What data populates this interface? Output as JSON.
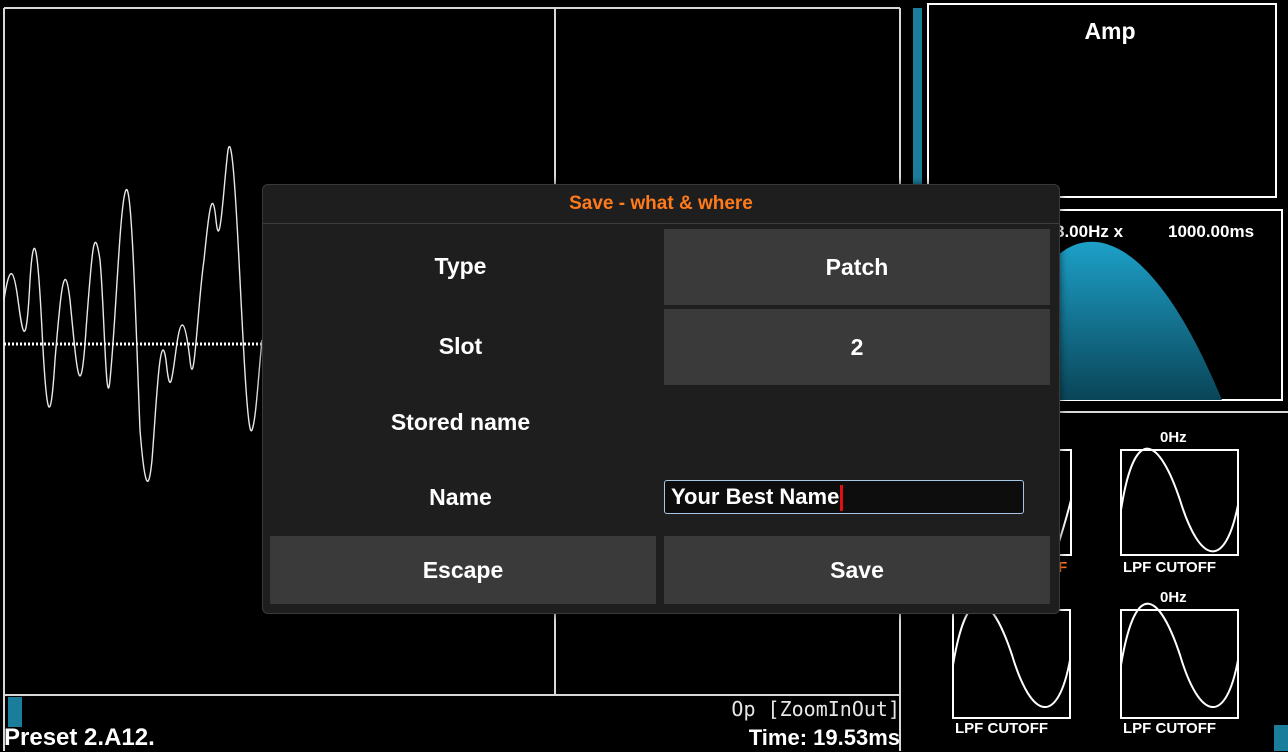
{
  "panels": {
    "amp_title": "Amp",
    "env_rate": "8.00Hz x",
    "env_time": "1000.00ms",
    "lfo_freq_top": "0Hz",
    "lfo_freq_bottom": "0Hz",
    "lfo_label_a": "LPF CUTOFF",
    "lfo_label_b": "LPF CUTOFF",
    "lfo_label_c": "LPF CUTOFF",
    "lfo_label_partial": "F"
  },
  "status": {
    "preset": "Preset 2.A12.",
    "op": "Op [ZoomInOut]",
    "time": "Time: 19.53ms"
  },
  "dialog": {
    "title": "Save - what & where",
    "rows": {
      "type_label": "Type",
      "type_value": "Patch",
      "slot_label": "Slot",
      "slot_value": "2",
      "stored_name_label": "Stored name",
      "stored_name_value": "",
      "name_label": "Name",
      "name_value": "Your Best Name"
    },
    "buttons": {
      "escape": "Escape",
      "save": "Save"
    }
  },
  "colors": {
    "accent": "#1b7d9c",
    "title": "#ff7a1a",
    "caret": "#dd1111"
  }
}
